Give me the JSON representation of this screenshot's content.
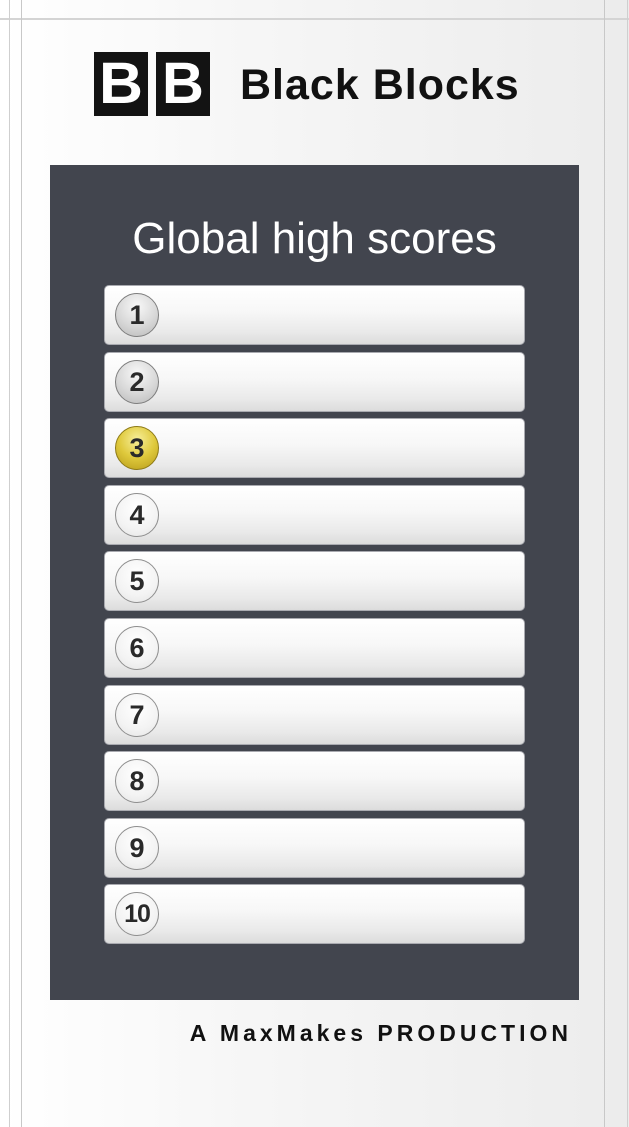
{
  "app": {
    "logo_letters": [
      "B",
      "B"
    ],
    "title": "Black Blocks"
  },
  "panel": {
    "title": "Global high scores"
  },
  "scores": [
    {
      "rank": "1",
      "medal": "silver",
      "value": ""
    },
    {
      "rank": "2",
      "medal": "silver",
      "value": ""
    },
    {
      "rank": "3",
      "medal": "gold",
      "value": ""
    },
    {
      "rank": "4",
      "medal": "none",
      "value": ""
    },
    {
      "rank": "5",
      "medal": "none",
      "value": ""
    },
    {
      "rank": "6",
      "medal": "none",
      "value": ""
    },
    {
      "rank": "7",
      "medal": "none",
      "value": ""
    },
    {
      "rank": "8",
      "medal": "none",
      "value": ""
    },
    {
      "rank": "9",
      "medal": "none",
      "value": ""
    },
    {
      "rank": "10",
      "medal": "none",
      "value": ""
    }
  ],
  "footer": {
    "credit": "A MaxMakes PRODUCTION"
  },
  "colors": {
    "panel_background": "#42454e",
    "logo_block": "#131313",
    "gold_badge": "#dfc93c",
    "silver_badge": "#d8d8d8"
  }
}
